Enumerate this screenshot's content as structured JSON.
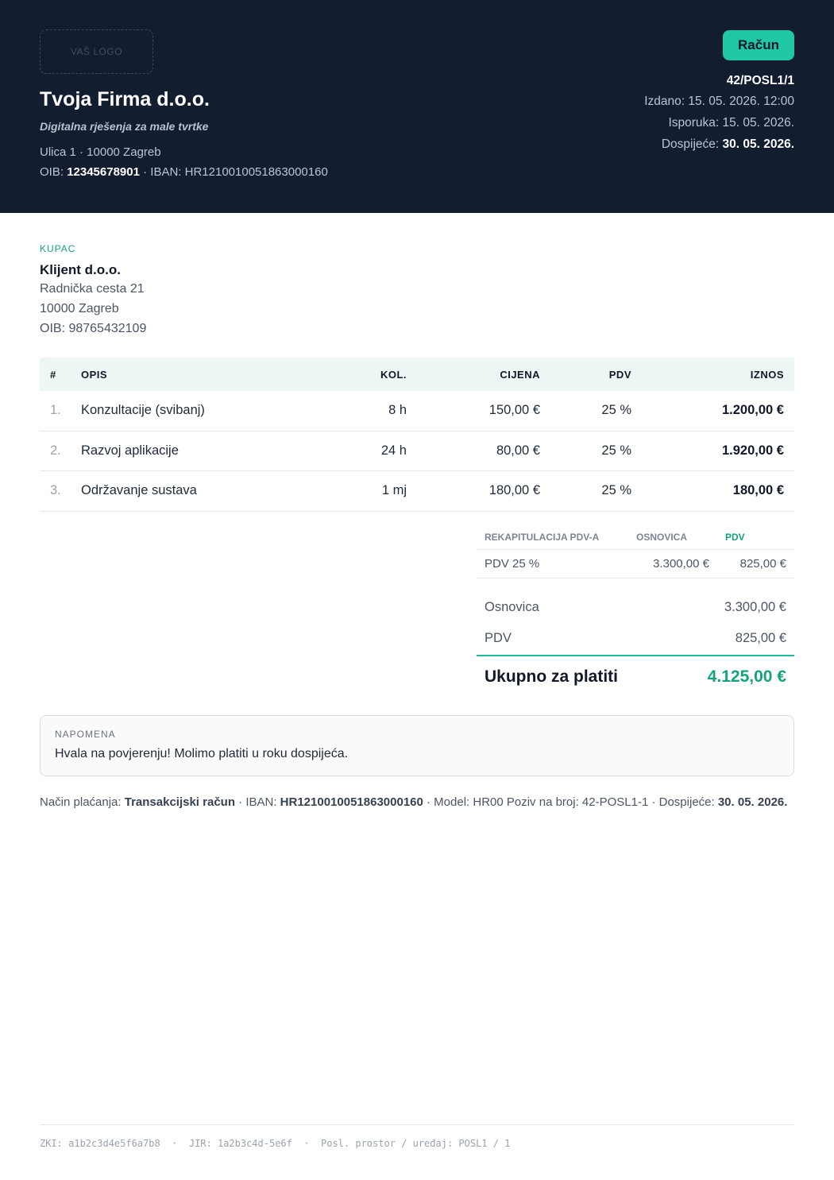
{
  "header": {
    "logo_placeholder": "VAŠ LOGO",
    "company_name": "Tvoja Firma d.o.o.",
    "tagline": "Digitalna rješenja za male tvrtke",
    "address": "Ulica 1 · 10000 Zagreb",
    "oib_label": "OIB: ",
    "oib": "12345678901",
    "iban_text": " · IBAN: HR1210010051863000160",
    "doc_type": "Račun",
    "invoice_number": "42/POSL1/1",
    "issued": "Izdano: 15. 05. 2026. 12:00",
    "delivery": "Isporuka: 15. 05. 2026.",
    "due_label": "Dospijeće: ",
    "due_date": "30. 05. 2026."
  },
  "buyer": {
    "label": "KUPAC",
    "name": "Klijent d.o.o.",
    "street": "Radnička cesta 21",
    "city": "10000 Zagreb",
    "oib": "OIB: 98765432109"
  },
  "items": {
    "columns": [
      "#",
      "OPIS",
      "KOL.",
      "CIJENA",
      "PDV",
      "IZNOS"
    ],
    "rows": [
      [
        "1.",
        "Konzultacije (svibanj)",
        "8 h",
        "150,00 €",
        "25 %",
        "1.200,00 €"
      ],
      [
        "2.",
        "Razvoj aplikacije",
        "24 h",
        "80,00 €",
        "25 %",
        "1.920,00 €"
      ],
      [
        "3.",
        "Održavanje sustava",
        "1 mj",
        "180,00 €",
        "25 %",
        "180,00 €"
      ]
    ]
  },
  "vat_recap": {
    "columns": [
      "REKAPITULACIJA PDV-A",
      "OSNOVICA",
      "PDV"
    ],
    "row": [
      "PDV 25 %",
      "3.300,00 €",
      "825,00 €"
    ]
  },
  "summary": {
    "base_label": "Osnovica",
    "base_value": "3.300,00 €",
    "vat_label": "PDV",
    "vat_value": "825,00 €",
    "total_label": "Ukupno za platiti",
    "total_value": "4.125,00 €"
  },
  "note": {
    "label": "NAPOMENA",
    "text": "Hvala na povjerenju! Molimo platiti u roku dospijeća."
  },
  "payment": {
    "method_label": "Način plaćanja: ",
    "method": "Transakcijski račun",
    "iban_label": " · IBAN: ",
    "iban": "HR1210010051863000160",
    "model_text": " · Model: HR00   Poziv na broj: 42-POSL1-1 · Dospijeće: ",
    "due": "30. 05. 2026."
  },
  "fiscal": {
    "text": "ZKI: a1b2c3d4e5f6a7b8  ·  JIR: 1a2b3c4d-5e6f  ·  Posl. prostor / uređaj: POSL1 / 1"
  },
  "colors": {
    "header_bg": "#121d2f",
    "accent": "#1fc7a4",
    "accent_text": "#14a37f"
  }
}
